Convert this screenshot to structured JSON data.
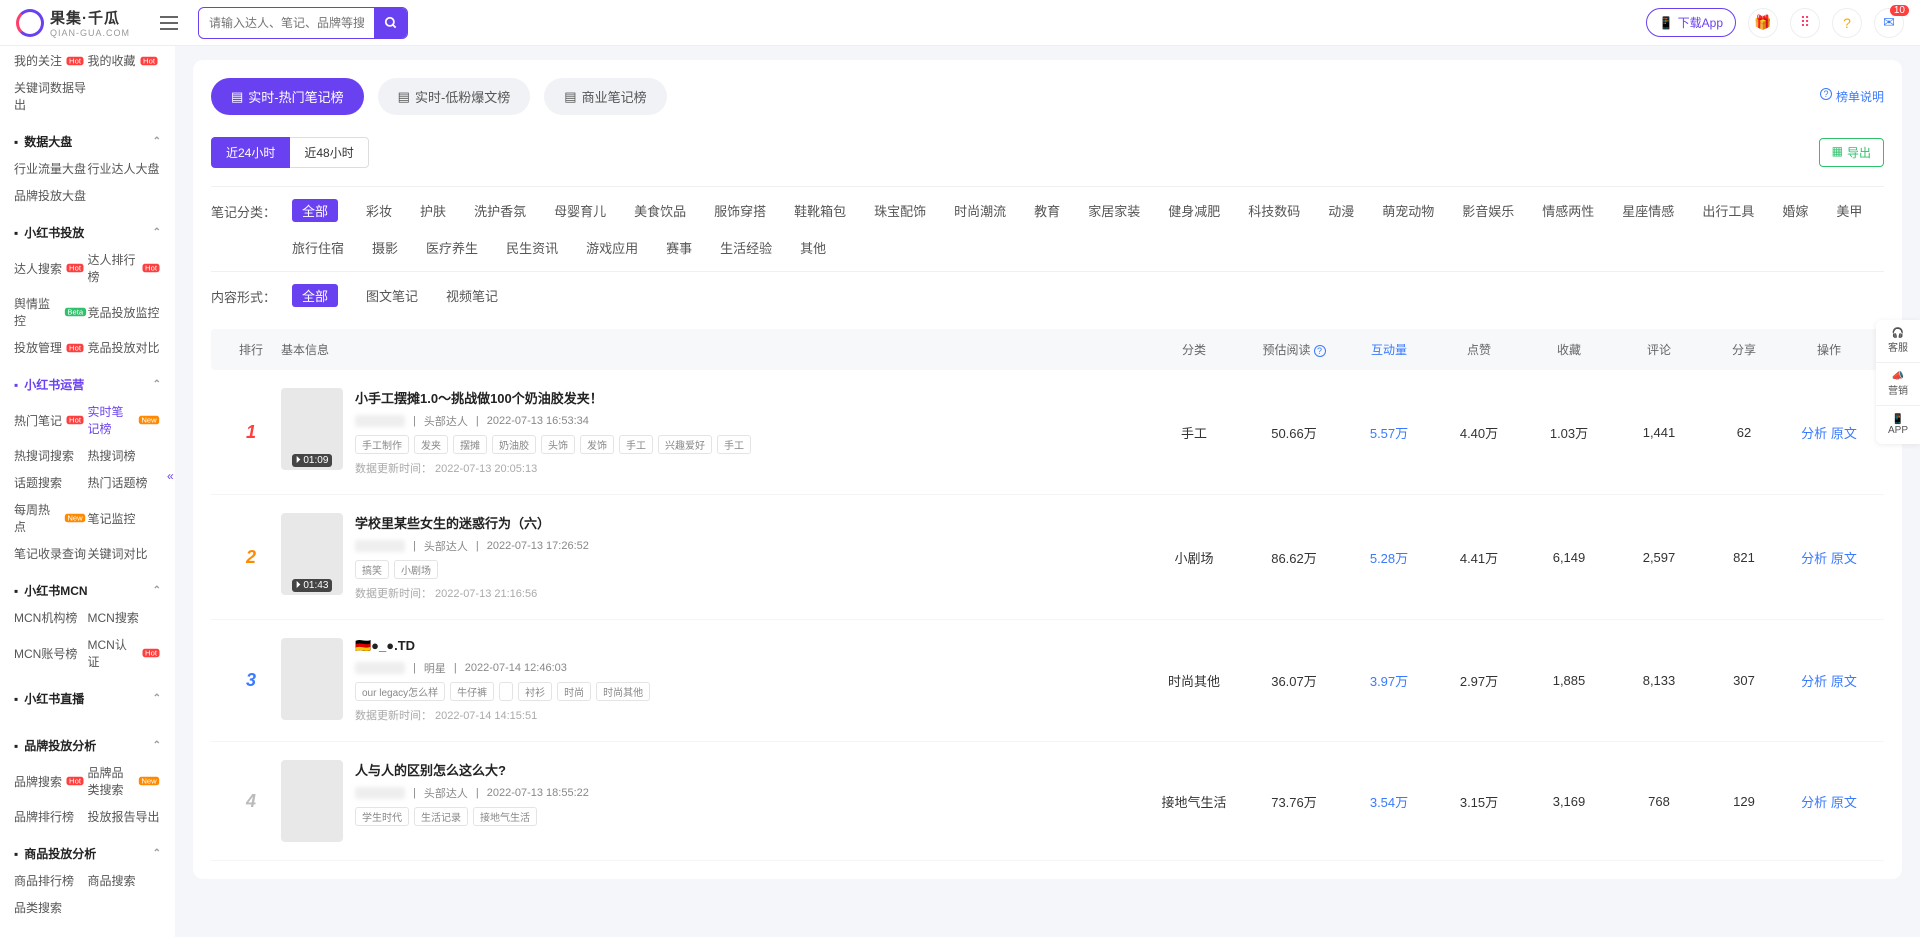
{
  "logo": {
    "text": "果集·千瓜",
    "sub": "QIAN-GUA.COM"
  },
  "search": {
    "placeholder": "请输入达人、笔记、品牌等搜索"
  },
  "header": {
    "download": "下载App",
    "badge": "10"
  },
  "sidebar_top": [
    "我的关注",
    "我的收藏",
    "关键词数据导出"
  ],
  "sections": [
    {
      "title": "数据大盘",
      "items": [
        [
          "行业流量大盘",
          ""
        ],
        [
          "行业达人大盘",
          ""
        ],
        [
          "品牌投放大盘",
          ""
        ]
      ]
    },
    {
      "title": "小红书投放",
      "items": [
        [
          "达人搜索",
          "hot"
        ],
        [
          "达人排行榜",
          "hot"
        ],
        [
          "舆情监控",
          "beta"
        ],
        [
          "竞品投放监控",
          ""
        ],
        [
          "投放管理",
          "hot"
        ],
        [
          "竞品投放对比",
          ""
        ]
      ]
    },
    {
      "title": "小红书运营",
      "active": true,
      "items": [
        [
          "热门笔记",
          "hot"
        ],
        [
          "实时笔记榜",
          "new",
          "active"
        ],
        [
          "热搜词搜索",
          ""
        ],
        [
          "热搜词榜",
          ""
        ],
        [
          "话题搜索",
          ""
        ],
        [
          "热门话题榜",
          ""
        ],
        [
          "每周热点",
          "new"
        ],
        [
          "笔记监控",
          ""
        ],
        [
          "笔记收录查询",
          ""
        ],
        [
          "关键词对比",
          ""
        ]
      ]
    },
    {
      "title": "小红书MCN",
      "items": [
        [
          "MCN机构榜",
          ""
        ],
        [
          "MCN搜索",
          ""
        ],
        [
          "MCN账号榜",
          ""
        ],
        [
          "MCN认证",
          "hot"
        ]
      ]
    },
    {
      "title": "小红书直播",
      "items": []
    },
    {
      "title": "品牌投放分析",
      "items": [
        [
          "品牌搜索",
          "hot"
        ],
        [
          "品牌品类搜索",
          "new"
        ],
        [
          "品牌排行榜",
          ""
        ],
        [
          "投放报告导出",
          ""
        ]
      ]
    },
    {
      "title": "商品投放分析",
      "items": [
        [
          "商品排行榜",
          ""
        ],
        [
          "商品搜索",
          ""
        ],
        [
          "品类搜索",
          ""
        ]
      ]
    }
  ],
  "tabs": [
    "实时-热门笔记榜",
    "实时-低粉爆文榜",
    "商业笔记榜"
  ],
  "rank_help": "榜单说明",
  "time_tabs": [
    "近24小时",
    "近48小时"
  ],
  "export": "导出",
  "filter1_label": "笔记分类：",
  "filter1": [
    "全部",
    "彩妆",
    "护肤",
    "洗护香氛",
    "母婴育儿",
    "美食饮品",
    "服饰穿搭",
    "鞋靴箱包",
    "珠宝配饰",
    "时尚潮流",
    "教育",
    "家居家装",
    "健身减肥",
    "科技数码",
    "动漫",
    "萌宠动物",
    "影音娱乐",
    "情感两性",
    "星座情感",
    "出行工具",
    "婚嫁",
    "美甲",
    "旅行住宿",
    "摄影",
    "医疗养生",
    "民生资讯",
    "游戏应用",
    "赛事",
    "生活经验",
    "其他"
  ],
  "filter2_label": "内容形式：",
  "filter2": [
    "全部",
    "图文笔记",
    "视频笔记"
  ],
  "columns": [
    "排行",
    "基本信息",
    "分类",
    "预估阅读",
    "互动量",
    "点赞",
    "收藏",
    "评论",
    "分享",
    "操作"
  ],
  "update_prefix": "数据更新时间：",
  "rows": [
    {
      "rank": 1,
      "dur": "01:09",
      "title": "小手工摆摊1.0～挑战做100个奶油胶发夹！",
      "author_type": "头部达人",
      "time": "2022-07-13 16:53:34",
      "tags": [
        "手工制作",
        "发夹",
        "摆摊",
        "奶油胶",
        "头饰",
        "发饰",
        "手工",
        "兴趣爱好",
        "手工"
      ],
      "update": "2022-07-13 20:05:13",
      "cat": "手工",
      "read": "50.66万",
      "inter": "5.57万",
      "like": "4.40万",
      "col": "1.03万",
      "com": "1,441",
      "share": "62"
    },
    {
      "rank": 2,
      "dur": "01:43",
      "title": "学校里某些女生的迷惑行为（六）",
      "author_type": "头部达人",
      "time": "2022-07-13 17:26:52",
      "tags": [
        "搞笑",
        "小剧场"
      ],
      "update": "2022-07-13 21:16:56",
      "cat": "小剧场",
      "read": "86.62万",
      "inter": "5.28万",
      "like": "4.41万",
      "col": "6,149",
      "com": "2,597",
      "share": "821"
    },
    {
      "rank": 3,
      "dur": "",
      "title": "🇩🇪●_●.TD",
      "author_type": "明星",
      "time": "2022-07-14 12:46:03",
      "tags": [
        "our legacy怎么样",
        "牛仔裤",
        "",
        "衬衫",
        "时尚",
        "时尚其他"
      ],
      "update": "2022-07-14 14:15:51",
      "cat": "时尚其他",
      "read": "36.07万",
      "inter": "3.97万",
      "like": "2.97万",
      "col": "1,885",
      "com": "8,133",
      "share": "307"
    },
    {
      "rank": 4,
      "dur": "",
      "title": "人与人的区别怎么这么大?",
      "author_type": "头部达人",
      "time": "2022-07-13 18:55:22",
      "tags": [
        "学生时代",
        "生活记录",
        "接地气生活"
      ],
      "update": "",
      "cat": "接地气生活",
      "read": "73.76万",
      "inter": "3.54万",
      "like": "3.15万",
      "col": "3,169",
      "com": "768",
      "share": "129"
    }
  ],
  "op": [
    "分析",
    "原文"
  ],
  "rail": [
    "客服",
    "营销",
    "APP"
  ]
}
